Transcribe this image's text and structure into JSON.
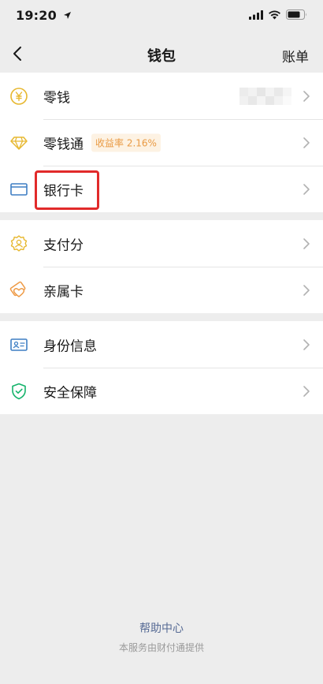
{
  "status_bar": {
    "time": "19:20"
  },
  "nav": {
    "title": "钱包",
    "bill_label": "账单"
  },
  "sections": [
    {
      "items": [
        {
          "key": "change",
          "label": "零钱",
          "icon": "yuan-coin-icon"
        },
        {
          "key": "lingqiantong",
          "label": "零钱通",
          "icon": "diamond-icon",
          "badge": "收益率 2.16%"
        },
        {
          "key": "bank_card",
          "label": "银行卡",
          "icon": "bank-card-icon"
        }
      ]
    },
    {
      "items": [
        {
          "key": "payment_score",
          "label": "支付分",
          "icon": "payment-score-icon"
        },
        {
          "key": "family_card",
          "label": "亲属卡",
          "icon": "family-card-icon"
        }
      ]
    },
    {
      "items": [
        {
          "key": "identity",
          "label": "身份信息",
          "icon": "id-card-icon"
        },
        {
          "key": "security",
          "label": "安全保障",
          "icon": "shield-check-icon"
        }
      ]
    }
  ],
  "footer": {
    "help_link": "帮助中心",
    "note": "本服务由财付通提供"
  },
  "colors": {
    "background": "#ededed",
    "gold": "#e7b830",
    "orange": "#ee9a45",
    "blue": "#3f7fc4",
    "green": "#15b36b",
    "link": "#576b95",
    "highlight": "#e12a2a"
  }
}
